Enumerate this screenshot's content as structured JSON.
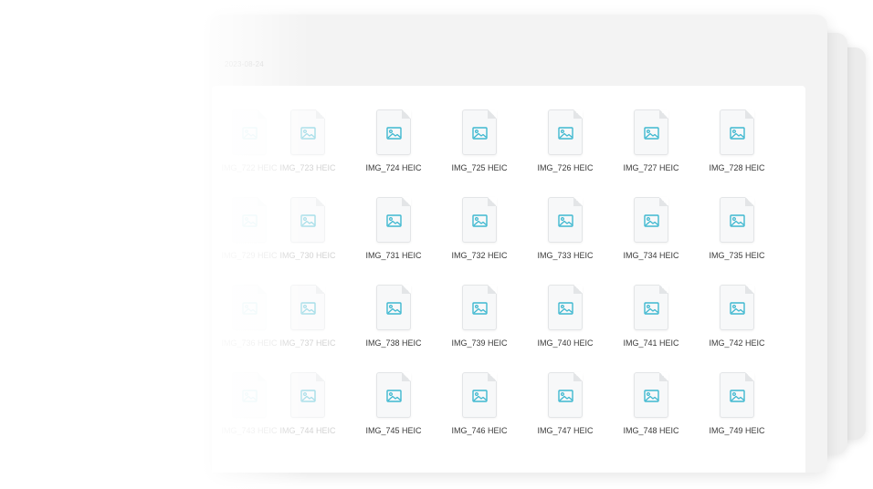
{
  "header": {
    "date_text": "2023-08-24"
  },
  "colors": {
    "icon_accent": "#3fb8d0",
    "window_bg": "#f3f3f3",
    "grid_bg": "#ffffff"
  },
  "file_icon": "image-file-icon",
  "rows": [
    {
      "files": [
        "IMG_722 HEIC",
        "IMG_723 HEIC",
        "IMG_724 HEIC",
        "IMG_725 HEIC",
        "IMG_726 HEIC",
        "IMG_727 HEIC",
        "IMG_728 HEIC"
      ]
    },
    {
      "files": [
        "IMG_729 HEIC",
        "IMG_730 HEIC",
        "IMG_731 HEIC",
        "IMG_732 HEIC",
        "IMG_733 HEIC",
        "IMG_734 HEIC",
        "IMG_735 HEIC"
      ]
    },
    {
      "files": [
        "IMG_736 HEIC",
        "IMG_737 HEIC",
        "IMG_738 HEIC",
        "IMG_739 HEIC",
        "IMG_740 HEIC",
        "IMG_741 HEIC",
        "IMG_742 HEIC"
      ]
    },
    {
      "files": [
        "IMG_743 HEIC",
        "IMG_744 HEIC",
        "IMG_745 HEIC",
        "IMG_746 HEIC",
        "IMG_747 HEIC",
        "IMG_748 HEIC",
        "IMG_749 HEIC"
      ]
    }
  ]
}
